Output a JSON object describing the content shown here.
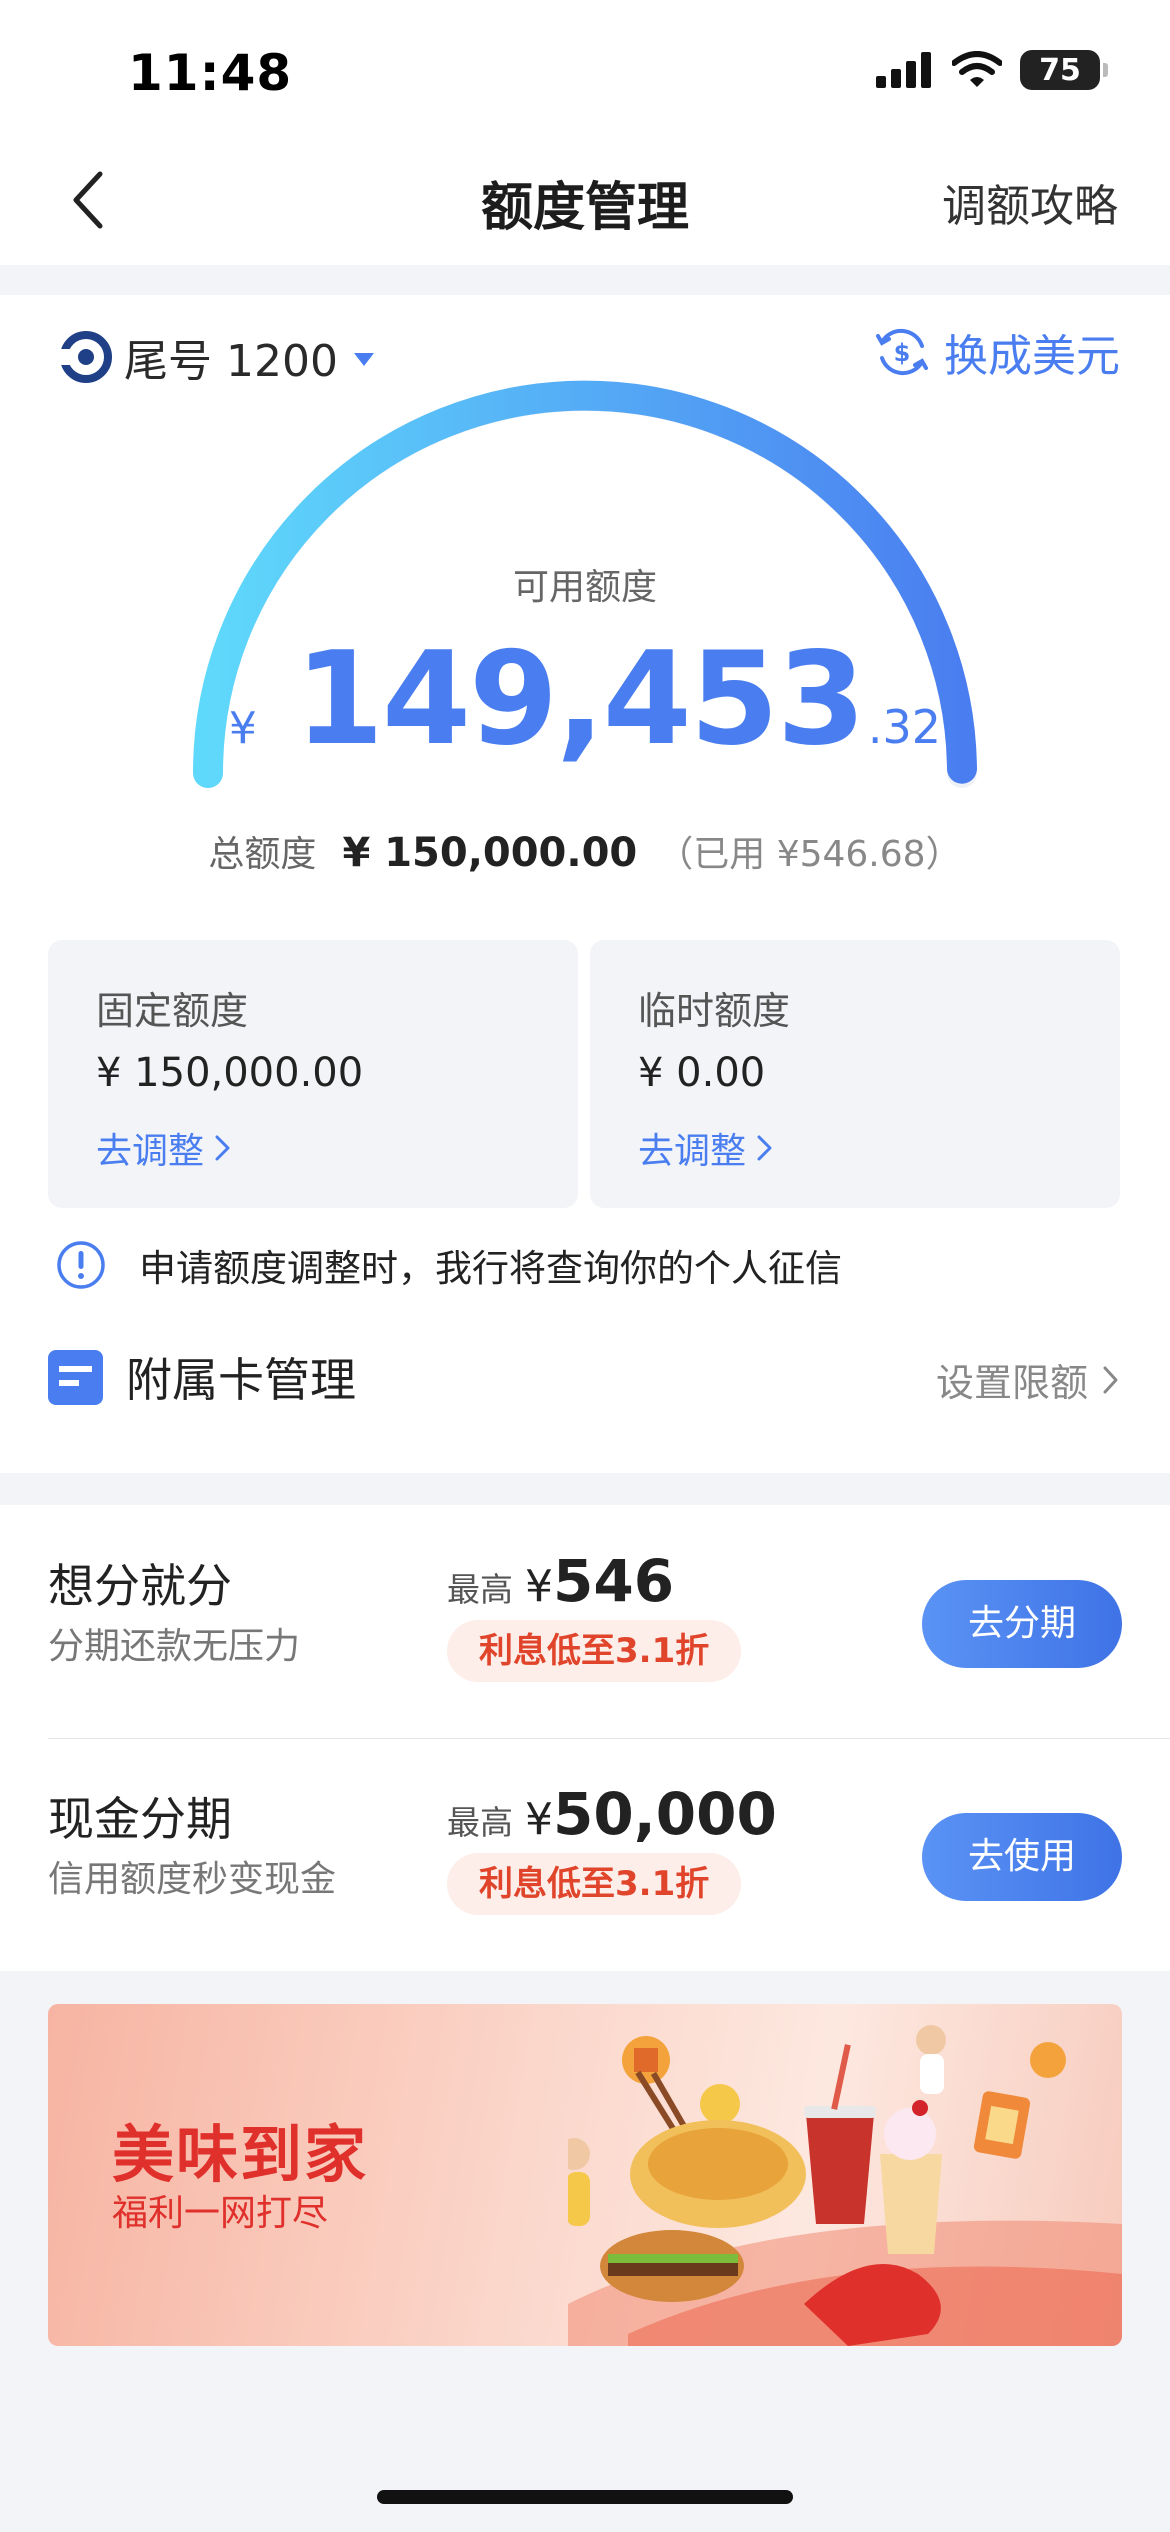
{
  "status_bar": {
    "time": "11:48",
    "battery": "75"
  },
  "nav": {
    "title": "额度管理",
    "right_label": "调额攻略"
  },
  "card": {
    "number_label": "尾号 1200",
    "convert_label": "换成美元"
  },
  "available": {
    "label": "可用额度",
    "currency": "¥",
    "integer": "149,453",
    "decimal": ".32",
    "fraction_of_total": 0.9964
  },
  "total": {
    "label": "总额度",
    "value": "¥ 150,000.00",
    "used": "（已用 ¥546.68）"
  },
  "limits": [
    {
      "title": "固定额度",
      "value": "¥ 150,000.00",
      "link": "去调整"
    },
    {
      "title": "临时额度",
      "value": "¥ 0.00",
      "link": "去调整"
    }
  ],
  "notice": "申请额度调整时，我行将查询你的个人征信",
  "sub_card": {
    "title": "附属卡管理",
    "action": "设置限额"
  },
  "installments": [
    {
      "title": "想分就分",
      "subtitle": "分期还款无压力",
      "max_label": "最高",
      "max_symbol": "¥",
      "max_value": "546",
      "tag": "利息低至3.1折",
      "button": "去分期"
    },
    {
      "title": "现金分期",
      "subtitle": "信用额度秒变现金",
      "max_label": "最高",
      "max_symbol": "¥",
      "max_value": "50,000",
      "tag": "利息低至3.1折",
      "button": "去使用"
    }
  ],
  "banner": {
    "title": "美味到家",
    "subtitle": "福利一网打尽"
  },
  "colors": {
    "accent": "#4a7ef0",
    "gauge_start": "#5fd9fb",
    "gauge_end": "#4a7ef0",
    "promo": "#e0302c"
  }
}
